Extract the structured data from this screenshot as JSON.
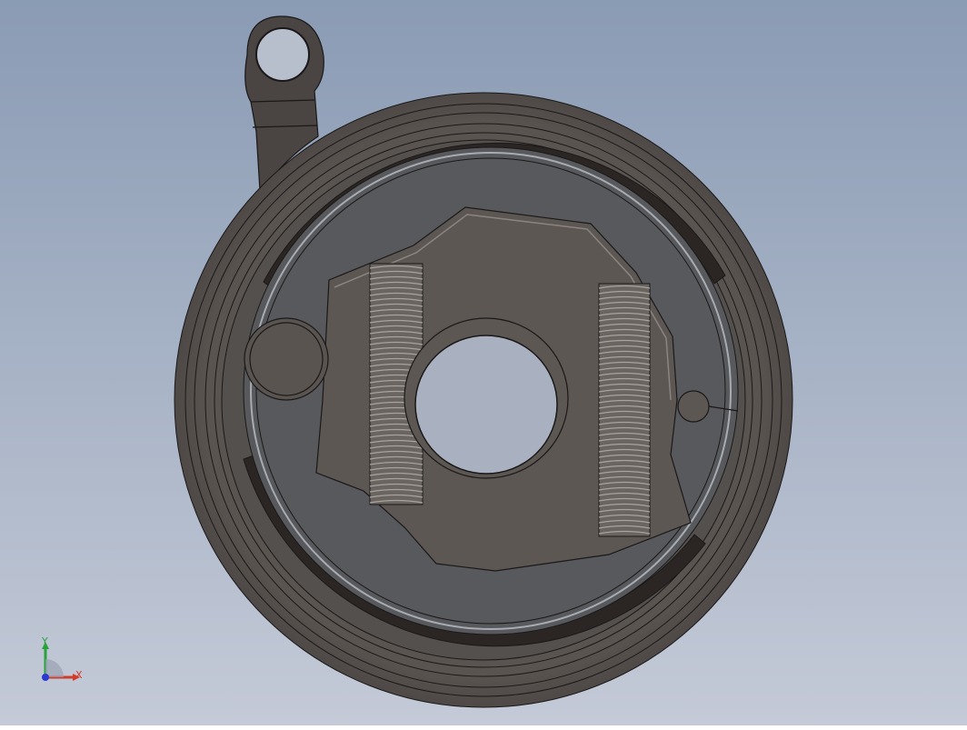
{
  "viewport": {
    "background_top": "#8c9db5",
    "background_bottom": "#c3c9d6"
  },
  "model": {
    "part_color": "#5d5753",
    "shoe_color": "#57595c",
    "lining_color": "#2b2624",
    "edge_color": "#1a1818"
  },
  "triad": {
    "x_label": "X",
    "y_label": "Y",
    "x_color": "#d23a2a",
    "y_color": "#2aa23a",
    "z_color": "#2a3ad2"
  }
}
